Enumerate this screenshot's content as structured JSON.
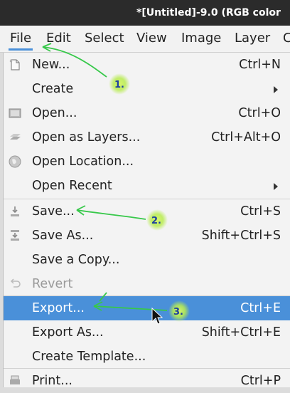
{
  "window": {
    "title": "*[Untitled]-9.0 (RGB color"
  },
  "menubar": {
    "items": [
      "File",
      "Edit",
      "Select",
      "View",
      "Image",
      "Layer",
      "C"
    ]
  },
  "file_menu": {
    "items": [
      {
        "label": "New...",
        "accel": "Ctrl+N",
        "icon": "new-document-icon"
      },
      {
        "label": "Create",
        "accel": "",
        "submenu": true
      },
      {
        "label": "Open...",
        "accel": "Ctrl+O",
        "icon": "open-image-icon"
      },
      {
        "label": "Open as Layers...",
        "accel": "Ctrl+Alt+O",
        "icon": "layers-icon"
      },
      {
        "label": "Open Location...",
        "accel": "",
        "icon": "globe-icon"
      },
      {
        "label": "Open Recent",
        "accel": "",
        "submenu": true
      },
      {
        "label": "Save...",
        "accel": "Ctrl+S",
        "icon": "save-icon"
      },
      {
        "label": "Save As...",
        "accel": "Shift+Ctrl+S",
        "icon": "save-as-icon"
      },
      {
        "label": "Save a Copy...",
        "accel": ""
      },
      {
        "label": "Revert",
        "accel": "",
        "icon": "revert-icon",
        "disabled": true
      },
      {
        "label": "Export...",
        "accel": "Ctrl+E",
        "highlighted": true
      },
      {
        "label": "Export As...",
        "accel": "Shift+Ctrl+E"
      },
      {
        "label": "Create Template...",
        "accel": ""
      },
      {
        "label": "Print...",
        "accel": "Ctrl+P",
        "icon": "print-icon"
      }
    ]
  },
  "annotations": {
    "step1": "1.",
    "step2": "2.",
    "step3": "3."
  },
  "colors": {
    "highlight": "#4a90d9",
    "annotation_arrow": "#37c84a",
    "annotation_glow": "#c8f05a",
    "annotation_text": "#1d3fa0"
  }
}
